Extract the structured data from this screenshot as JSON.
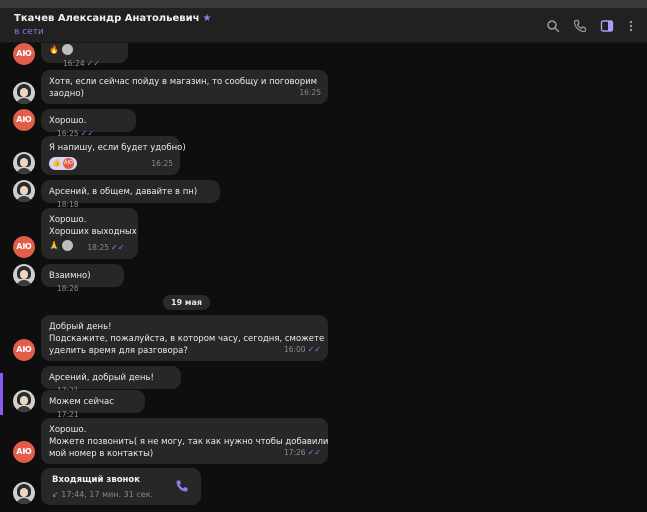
{
  "header": {
    "contact_name": "Ткачев Александр Анатольевич",
    "star": "★",
    "status": "в сети",
    "icons": [
      "search-icon",
      "phone-icon",
      "sidebar-toggle-icon",
      "more-vert-icon"
    ]
  },
  "colors": {
    "accent": "#8a78e8",
    "bubble": "#272727",
    "avatar_initials_bg": "#e35d4b"
  },
  "messages": [
    {
      "avatar": "АЮ",
      "lines": [],
      "time": "16:24",
      "reactions": [
        "🔥",
        "photo"
      ],
      "read": true
    },
    {
      "avatar": "photo",
      "lines": [
        "Хотя, если сейчас пойду в магазин, то сообщу и поговорим",
        "заодно)"
      ],
      "time": "16:25"
    },
    {
      "avatar": "АЮ",
      "lines": [
        "Хорошо."
      ],
      "time": "16:25",
      "read": true
    },
    {
      "avatar": "photo",
      "lines": [
        "Я напишу, если будет удобно)"
      ],
      "time": "16:25",
      "reactions": [
        "👍",
        "АЮ"
      ]
    },
    {
      "avatar": "photo",
      "lines": [
        "Арсений, в общем, давайте в пн)"
      ],
      "time": "18:18"
    },
    {
      "avatar": "АЮ",
      "lines": [
        "Хорошо.",
        "Хороших выходных"
      ],
      "time": "18:25",
      "reactions": [
        "🙏",
        "photo"
      ],
      "read": true
    },
    {
      "avatar": "photo",
      "lines": [
        "Взаимно)"
      ],
      "time": "18:26"
    },
    {
      "avatar": "АЮ",
      "lines": [
        "Добрый день!",
        "Подскажите, пожалуйста, в котором часу, сегодня, сможете",
        "уделить время для разговора?"
      ],
      "time": "16:00",
      "read": true
    },
    {
      "avatar": "photo",
      "lines": [
        "Арсений, добрый день!"
      ],
      "time": "17:21"
    },
    {
      "avatar": "photo",
      "lines": [
        "Можем сейчас"
      ],
      "time": "17:21"
    },
    {
      "avatar": "АЮ",
      "lines": [
        "Хорошо.",
        "Можете позвонить( я не могу, так как нужно чтобы добавили",
        "мой номер в контакты)"
      ],
      "time": "17:26",
      "read": true
    }
  ],
  "date_separator": "19 мая",
  "call": {
    "title": "Входящий звонок",
    "arrow": "↙",
    "details": "17:44, 17 мин. 31 сек."
  }
}
